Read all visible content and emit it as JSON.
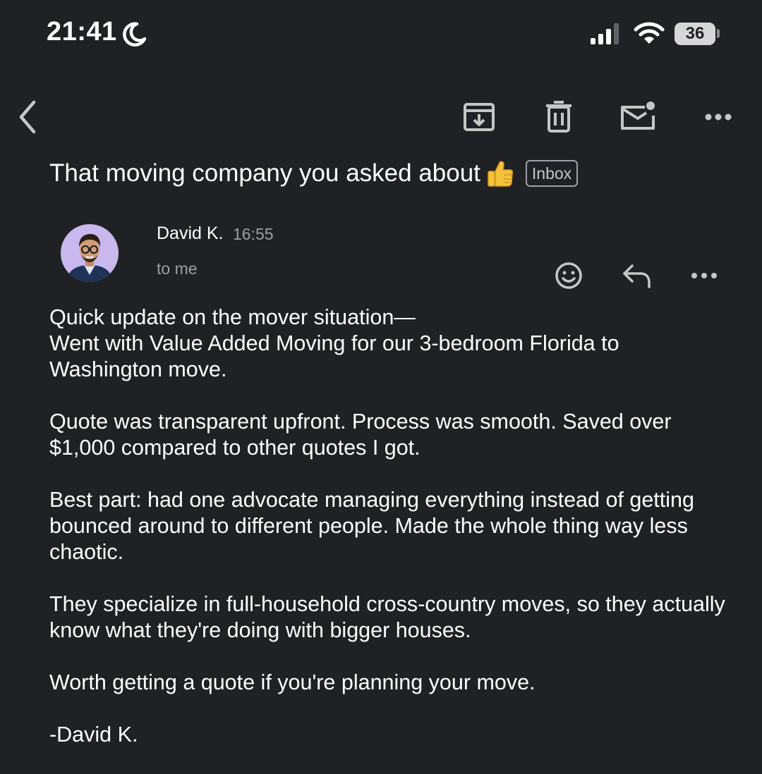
{
  "status_bar": {
    "time": "21:41",
    "battery": "36",
    "icons": [
      "moon-icon",
      "signal-icon",
      "wifi-icon",
      "battery-icon"
    ]
  },
  "toolbar": {
    "icons": [
      "back-arrow-icon",
      "archive-icon",
      "trash-icon",
      "mark-unread-icon",
      "more-icon"
    ]
  },
  "email": {
    "subject": "That moving company you asked about",
    "subject_emoji": "thumbs-up",
    "label": "Inbox",
    "sender": "David K.",
    "time": "16:55",
    "recipient": "to me",
    "actions": [
      "emoji-reaction-icon",
      "reply-icon",
      "more-icon"
    ],
    "body": [
      "Quick update on the mover situation—\nWent with Value Added Moving for our 3-bedroom Florida to Washington move.",
      "Quote was transparent upfront. Process was smooth. Saved over $1,000 compared to other quotes I got.",
      "Best part: had one advocate managing everything instead of getting bounced around to different people. Made the whole thing way less chaotic.",
      "They specialize in full-household cross-country moves, so they actually know what they're doing with bigger houses.",
      "Worth getting a quote if you're planning your move.",
      "-David K."
    ]
  },
  "colors": {
    "background": "#202124",
    "text": "#ffffff",
    "secondary_text": "#9aa0a6",
    "icon": "#c4c7c5",
    "avatar_bg": "#c9b8ee"
  }
}
